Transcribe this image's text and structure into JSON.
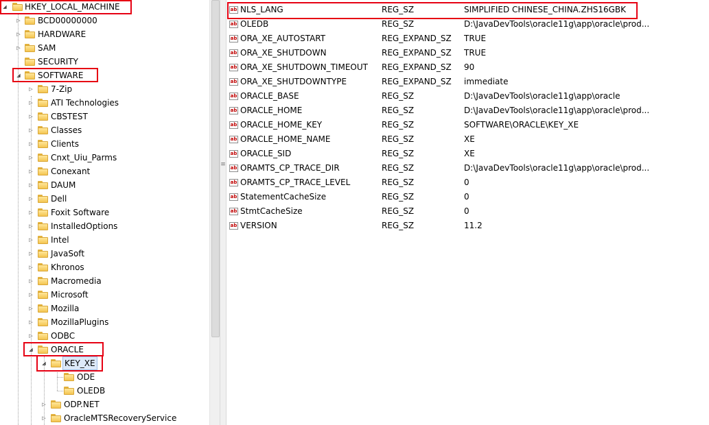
{
  "tree": {
    "root": "HKEY_LOCAL_MACHINE",
    "hklm_children": [
      "BCD00000000",
      "HARDWARE",
      "SAM",
      "SECURITY",
      "SOFTWARE"
    ],
    "software_children": [
      "7-Zip",
      "ATI Technologies",
      "CBSTEST",
      "Classes",
      "Clients",
      "Cnxt_Uiu_Parms",
      "Conexant",
      "DAUM",
      "Dell",
      "Foxit Software",
      "InstalledOptions",
      "Intel",
      "JavaSoft",
      "Khronos",
      "Macromedia",
      "Microsoft",
      "Mozilla",
      "MozillaPlugins",
      "ODBC",
      "ORACLE"
    ],
    "oracle_children": [
      "KEY_XE",
      "ODP.NET",
      "OracleMTSRecoveryService"
    ],
    "key_xe_children": [
      "ODE",
      "OLEDB"
    ],
    "selected_key": "KEY_XE"
  },
  "values": [
    {
      "name": "NLS_LANG",
      "type": "REG_SZ",
      "data": "SIMPLIFIED CHINESE_CHINA.ZHS16GBK"
    },
    {
      "name": "OLEDB",
      "type": "REG_SZ",
      "data": "D:\\JavaDevTools\\oracle11g\\app\\oracle\\prod..."
    },
    {
      "name": "ORA_XE_AUTOSTART",
      "type": "REG_EXPAND_SZ",
      "data": "TRUE"
    },
    {
      "name": "ORA_XE_SHUTDOWN",
      "type": "REG_EXPAND_SZ",
      "data": "TRUE"
    },
    {
      "name": "ORA_XE_SHUTDOWN_TIMEOUT",
      "type": "REG_EXPAND_SZ",
      "data": "90"
    },
    {
      "name": "ORA_XE_SHUTDOWNTYPE",
      "type": "REG_EXPAND_SZ",
      "data": "immediate"
    },
    {
      "name": "ORACLE_BASE",
      "type": "REG_SZ",
      "data": "D:\\JavaDevTools\\oracle11g\\app\\oracle"
    },
    {
      "name": "ORACLE_HOME",
      "type": "REG_SZ",
      "data": "D:\\JavaDevTools\\oracle11g\\app\\oracle\\prod..."
    },
    {
      "name": "ORACLE_HOME_KEY",
      "type": "REG_SZ",
      "data": "SOFTWARE\\ORACLE\\KEY_XE"
    },
    {
      "name": "ORACLE_HOME_NAME",
      "type": "REG_SZ",
      "data": "XE"
    },
    {
      "name": "ORACLE_SID",
      "type": "REG_SZ",
      "data": "XE"
    },
    {
      "name": "ORAMTS_CP_TRACE_DIR",
      "type": "REG_SZ",
      "data": "D:\\JavaDevTools\\oracle11g\\app\\oracle\\prod..."
    },
    {
      "name": "ORAMTS_CP_TRACE_LEVEL",
      "type": "REG_SZ",
      "data": "0"
    },
    {
      "name": "StatementCacheSize",
      "type": "REG_SZ",
      "data": "0"
    },
    {
      "name": "StmtCacheSize",
      "type": "REG_SZ",
      "data": "0"
    },
    {
      "name": "VERSION",
      "type": "REG_SZ",
      "data": "11.2"
    }
  ],
  "icons": {
    "value_icon": "string-value-icon",
    "value_icon_text": "ab",
    "folder_icon": "folder-icon",
    "expanded_glyph": "◢",
    "collapsed_glyph": "▷"
  },
  "colors": {
    "annotation_red": "#e60012",
    "folder_yellow": "#f4c552",
    "selection_blue": "#dde9f8"
  }
}
